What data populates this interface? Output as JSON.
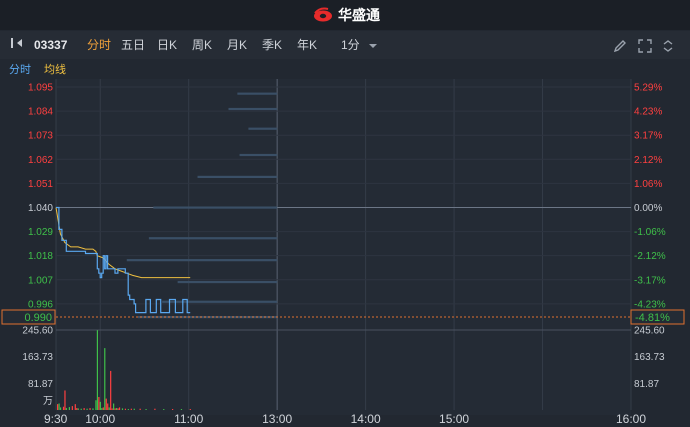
{
  "app": {
    "brand": "华盛通"
  },
  "toolbar": {
    "stock_code": "03337",
    "tabs": [
      {
        "label": "分时",
        "active": true
      },
      {
        "label": "五日",
        "active": false
      },
      {
        "label": "日K",
        "active": false
      },
      {
        "label": "周K",
        "active": false
      },
      {
        "label": "月K",
        "active": false
      },
      {
        "label": "季K",
        "active": false
      },
      {
        "label": "年K",
        "active": false
      }
    ],
    "interval": "1分",
    "icons": [
      "pencil-icon",
      "fullscreen-icon",
      "collapse-icon"
    ]
  },
  "legend": {
    "time_label": "分时",
    "avg_label": "均线"
  },
  "colors": {
    "up": "#ff4040",
    "down": "#3fc04a",
    "flat": "#c7ccd3",
    "price_line": "#5aa8f0",
    "avg_line": "#f0c040",
    "accent": "#f0a13a"
  },
  "chart_data": {
    "type": "line",
    "price_ticks": [
      "1.095",
      "1.084",
      "1.073",
      "1.062",
      "1.051",
      "1.040",
      "1.029",
      "1.018",
      "1.007",
      "0.996"
    ],
    "pct_ticks": [
      "5.29%",
      "4.23%",
      "3.17%",
      "2.12%",
      "1.06%",
      "0.00%",
      "-1.06%",
      "-2.12%",
      "-3.17%",
      "-4.23%"
    ],
    "prev_close": 1.04,
    "ylim": [
      0.99,
      1.095
    ],
    "current": {
      "price": "0.990",
      "pct": "-4.81%"
    },
    "time_ticks": [
      "9:30",
      "10:00",
      "11:00",
      "13:00",
      "14:00",
      "15:00",
      "16:00"
    ],
    "volume_ticks": [
      "245.60",
      "163.73",
      "81.87"
    ],
    "volume_unit": "万",
    "price_series": [
      [
        0,
        1.04
      ],
      [
        2,
        1.03
      ],
      [
        4,
        1.025
      ],
      [
        7,
        1.02
      ],
      [
        12,
        1.02
      ],
      [
        16,
        1.02
      ],
      [
        20,
        1.019
      ],
      [
        27,
        1.019
      ],
      [
        28,
        1.012
      ],
      [
        29,
        1.01
      ],
      [
        30,
        1.008
      ],
      [
        31,
        1.01
      ],
      [
        32,
        1.018
      ],
      [
        33,
        1.012
      ],
      [
        34,
        1.018
      ],
      [
        35,
        1.012
      ],
      [
        38,
        1.012
      ],
      [
        40,
        1.01
      ],
      [
        42,
        1.012
      ],
      [
        45,
        1.012
      ],
      [
        47,
        1.01
      ],
      [
        49,
        1.0
      ],
      [
        50,
        0.998
      ],
      [
        52,
        0.998
      ],
      [
        53,
        0.996
      ],
      [
        54,
        0.992
      ],
      [
        56,
        0.992
      ],
      [
        59,
        0.992
      ],
      [
        60,
        0.992
      ],
      [
        61,
        0.998
      ],
      [
        63,
        0.998
      ],
      [
        64,
        0.992
      ],
      [
        66,
        0.992
      ],
      [
        68,
        0.998
      ],
      [
        70,
        0.998
      ],
      [
        71,
        0.992
      ],
      [
        74,
        0.992
      ],
      [
        76,
        0.992
      ],
      [
        77,
        0.998
      ],
      [
        80,
        0.998
      ],
      [
        81,
        0.992
      ],
      [
        85,
        0.992
      ],
      [
        86,
        0.998
      ],
      [
        88,
        0.998
      ],
      [
        89,
        0.992
      ],
      [
        91,
        0.992
      ]
    ],
    "avg_series": [
      [
        0,
        1.04
      ],
      [
        3,
        1.028
      ],
      [
        6,
        1.024
      ],
      [
        10,
        1.022
      ],
      [
        15,
        1.022
      ],
      [
        20,
        1.021
      ],
      [
        25,
        1.021
      ],
      [
        27,
        1.02
      ],
      [
        28,
        1.018
      ],
      [
        32,
        1.017
      ],
      [
        36,
        1.014
      ],
      [
        40,
        1.012
      ],
      [
        44,
        1.011
      ],
      [
        48,
        1.01
      ],
      [
        52,
        1.009
      ],
      [
        58,
        1.008
      ],
      [
        65,
        1.008
      ],
      [
        75,
        1.008
      ],
      [
        85,
        1.008
      ],
      [
        91,
        1.008
      ]
    ],
    "volume_series": [
      [
        0,
        18,
        "up"
      ],
      [
        1,
        20,
        "down"
      ],
      [
        2,
        8,
        "down"
      ],
      [
        4,
        10,
        "up"
      ],
      [
        5,
        60,
        "up"
      ],
      [
        6,
        6,
        "down"
      ],
      [
        8,
        9,
        "down"
      ],
      [
        10,
        12,
        "up"
      ],
      [
        12,
        18,
        "up"
      ],
      [
        13,
        6,
        "up"
      ],
      [
        14,
        5,
        "down"
      ],
      [
        16,
        4,
        "down"
      ],
      [
        18,
        6,
        "up"
      ],
      [
        20,
        4,
        "down"
      ],
      [
        22,
        6,
        "up"
      ],
      [
        24,
        5,
        "down"
      ],
      [
        26,
        30,
        "down"
      ],
      [
        27,
        245,
        "down"
      ],
      [
        28,
        40,
        "up"
      ],
      [
        29,
        25,
        "down"
      ],
      [
        30,
        6,
        "down"
      ],
      [
        31,
        8,
        "up"
      ],
      [
        32,
        190,
        "down"
      ],
      [
        33,
        35,
        "up"
      ],
      [
        34,
        20,
        "up"
      ],
      [
        35,
        8,
        "down"
      ],
      [
        36,
        120,
        "up"
      ],
      [
        37,
        5,
        "up"
      ],
      [
        38,
        20,
        "down"
      ],
      [
        39,
        5,
        "up"
      ],
      [
        40,
        6,
        "down"
      ],
      [
        41,
        5,
        "up"
      ],
      [
        42,
        8,
        "up"
      ],
      [
        44,
        5,
        "down"
      ],
      [
        46,
        4,
        "up"
      ],
      [
        48,
        3,
        "down"
      ],
      [
        50,
        4,
        "up"
      ],
      [
        52,
        4,
        "down"
      ],
      [
        56,
        4,
        "up"
      ],
      [
        60,
        3,
        "down"
      ],
      [
        66,
        4,
        "up"
      ],
      [
        72,
        3,
        "down"
      ],
      [
        78,
        3,
        "up"
      ],
      [
        84,
        3,
        "down"
      ],
      [
        90,
        3,
        "up"
      ]
    ],
    "order_depth": [
      [
        1.092,
        0.18
      ],
      [
        1.085,
        0.22
      ],
      [
        1.076,
        0.13
      ],
      [
        1.064,
        0.17
      ],
      [
        1.054,
        0.36
      ],
      [
        1.04,
        0.56
      ],
      [
        1.026,
        0.58
      ],
      [
        1.016,
        0.68
      ],
      [
        1.006,
        0.45
      ],
      [
        0.997,
        0.52
      ],
      [
        0.99,
        0.63
      ]
    ]
  }
}
